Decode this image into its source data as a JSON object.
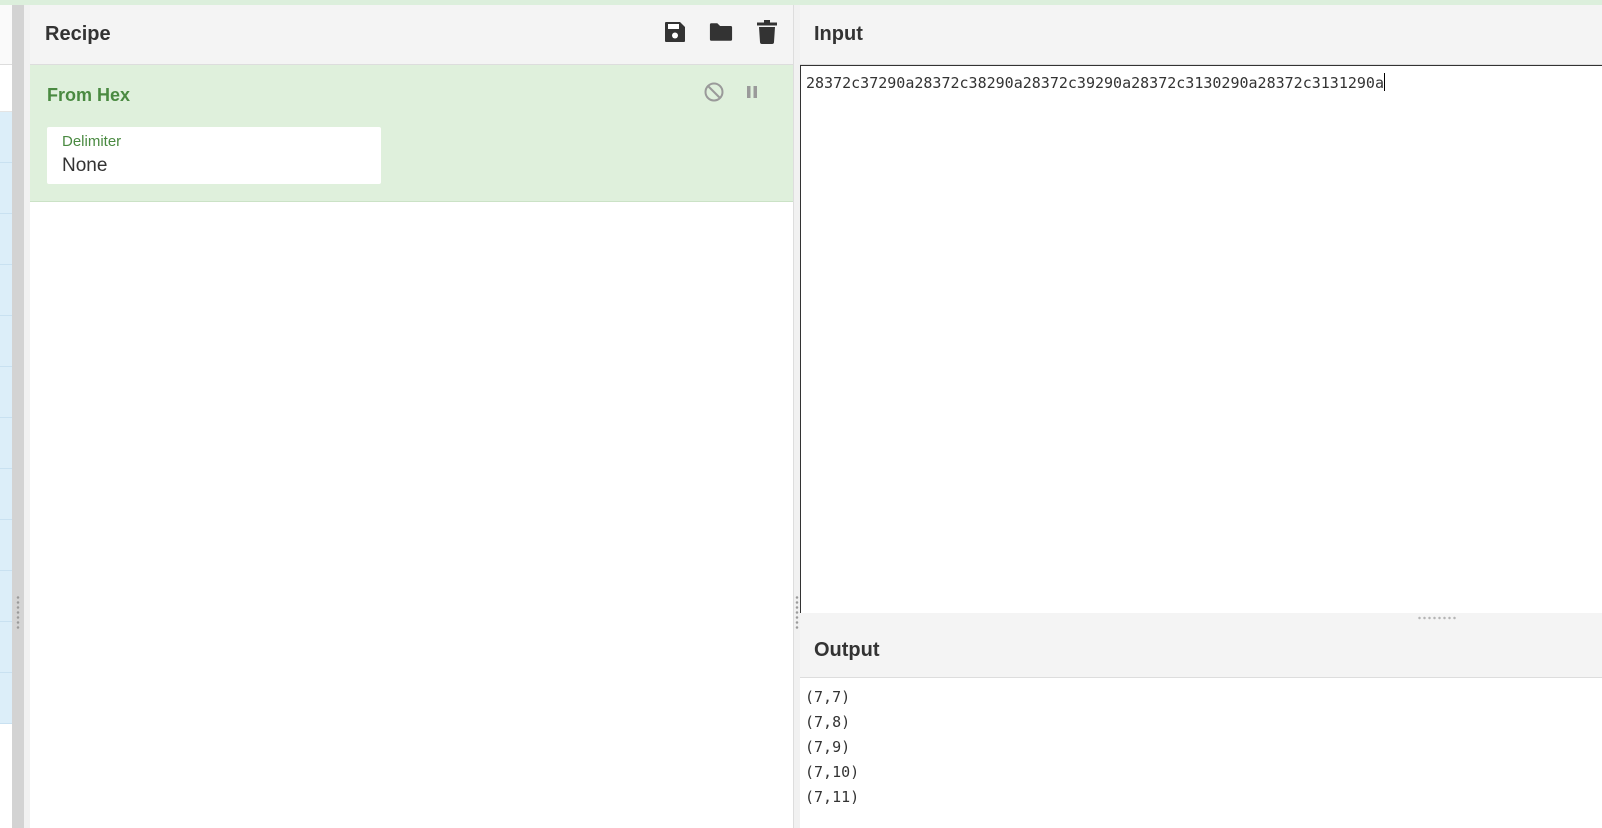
{
  "recipe": {
    "title": "Recipe",
    "icons": [
      "save-icon",
      "folder-icon",
      "trash-icon"
    ],
    "operation": {
      "name": "From Hex",
      "controls": [
        "disable-icon",
        "pause-icon"
      ],
      "argument": {
        "label": "Delimiter",
        "value": "None"
      }
    }
  },
  "input": {
    "title": "Input",
    "text": "28372c37290a28372c38290a28372c39290a28372c3130290a28372c3131290a"
  },
  "output": {
    "title": "Output",
    "lines": [
      "(7,7)",
      "(7,8)",
      "(7,9)",
      "(7,10)",
      "(7,11)"
    ]
  },
  "colors": {
    "operation_bg": "#dff0dc",
    "operation_text": "#4a8a41",
    "ops_highlight": "#dceef9"
  }
}
